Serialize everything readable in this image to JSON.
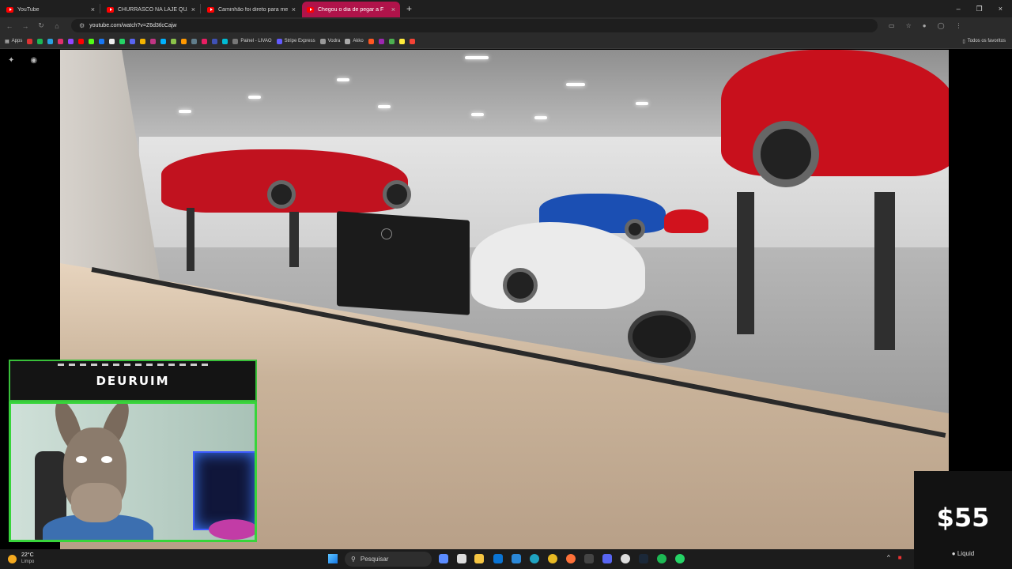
{
  "browser": {
    "tabs": [
      {
        "label": "YouTube",
        "active": false
      },
      {
        "label": "CHURRASCO NA LAJE QUASE",
        "active": false
      },
      {
        "label": "Caminhão foi direto para mecâ",
        "active": false
      },
      {
        "label": "Chegou o dia de pegar a F",
        "active": true
      }
    ],
    "close_glyph": "×",
    "new_tab_glyph": "+",
    "window_controls": [
      "–",
      "❐",
      "×"
    ],
    "url": "youtube.com/watch?v=Z6d3tlcCajw",
    "bookmarks_apps_label": "Apps",
    "bookmarks_named": [
      "Painel - LIVAO",
      "Stripe Express",
      "Vodra",
      "Akko"
    ],
    "bookmarks_right_label": "Todos os favoritos",
    "accent_color": "#b0134a"
  },
  "overlay": {
    "streamer_name": "DEURUIM",
    "frame_color": "#38d43b"
  },
  "donation": {
    "amount": "$55",
    "source": "Liquid"
  },
  "taskbar": {
    "temperature": "22°C",
    "condition": "Limpo",
    "search_placeholder": "Pesquisar"
  }
}
